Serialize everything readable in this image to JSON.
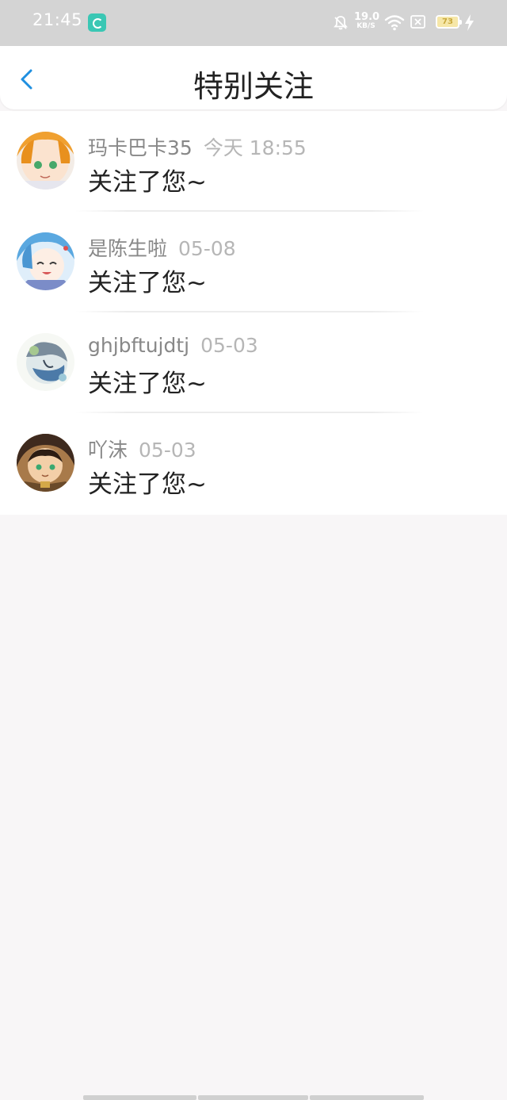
{
  "status_bar": {
    "time": "21:45",
    "network_speed_value": "19.0",
    "network_speed_unit": "KB/S",
    "battery_level": "73",
    "colors": {
      "background": "#d4d4d4",
      "app_icon": "#3ac7b4",
      "battery_fill": "#f6e7a8"
    }
  },
  "header": {
    "title": "特别关注",
    "back_icon": "chevron-left-icon",
    "accent_color": "#1f8fe0"
  },
  "items": [
    {
      "username": "玛卡巴卡35",
      "time": "今天 18:55",
      "message": "关注了您~"
    },
    {
      "username": "是陈生啦",
      "time": "05-08",
      "message": "关注了您~"
    },
    {
      "username": "ghjbftujdtj",
      "time": "05-03",
      "message": "关注了您~"
    },
    {
      "username": "吖沫",
      "time": "05-03",
      "message": "关注了您~"
    }
  ]
}
